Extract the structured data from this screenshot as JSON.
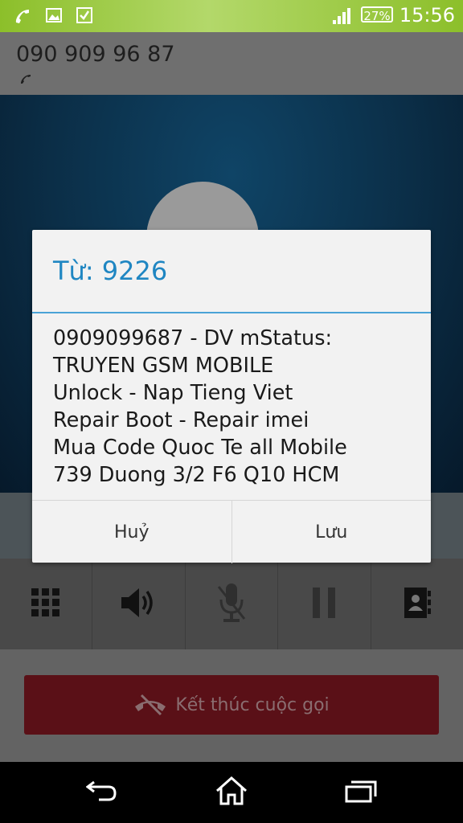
{
  "status_bar": {
    "icons_left": [
      "phone-icon",
      "image-icon",
      "checkbox-icon"
    ],
    "signal_icon": "signal-icon",
    "battery": "27%",
    "time": "15:56"
  },
  "call": {
    "number": "090 909 96 87",
    "controls": [
      "dialpad-icon",
      "speaker-icon",
      "mute-microphone-icon",
      "hold-pause-icon",
      "contacts-icon"
    ],
    "end_call_label": "Kết thúc cuộc gọi"
  },
  "dialog": {
    "title": "Từ: 9226",
    "body_lines": [
      "0909099687 - DV mStatus:",
      "TRUYEN GSM MOBILE",
      "Unlock - Nap Tieng Viet",
      "Repair Boot - Repair imei",
      "Mua Code Quoc Te all Mobile",
      "739 Duong 3/2 F6 Q10 HCM"
    ],
    "cancel_label": "Huỷ",
    "save_label": "Lưu"
  },
  "nav": [
    "back-icon",
    "home-icon",
    "recent-apps-icon"
  ],
  "colors": {
    "status_bar": "#8cbf2a",
    "dialog_accent": "#1f86c2",
    "end_call": "#5a1017"
  }
}
